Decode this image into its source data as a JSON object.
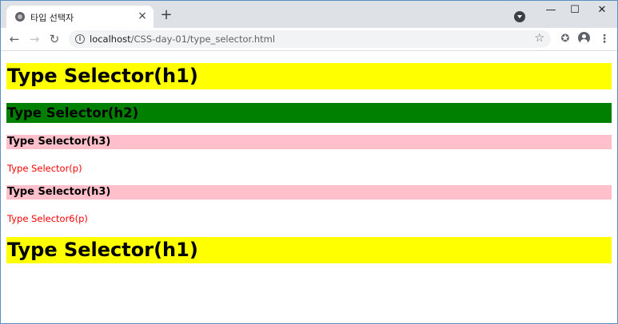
{
  "browser": {
    "tab_title": "타입 선택자",
    "tab_close": "×",
    "new_tab": "+",
    "url_host": "localhost",
    "url_path": "/CSS-day-01/type_selector.html",
    "window_controls": {
      "minimize": "—",
      "maximize": "☐",
      "close": "✕"
    },
    "icons": [
      "globe-icon",
      "back-icon",
      "forward-icon",
      "reload-icon",
      "info-icon",
      "star-icon",
      "extensions-icon",
      "profile-icon",
      "menu-icon",
      "tab-search-icon"
    ]
  },
  "page": {
    "blocks": [
      {
        "tag": "h1",
        "text": "Type Selector(h1)",
        "bg": "#ffff00"
      },
      {
        "tag": "h2",
        "text": "Type Selector(h2)",
        "bg": "#008000"
      },
      {
        "tag": "h3",
        "text": "Type Selector(h3)",
        "bg": "#ffc0cb"
      },
      {
        "tag": "p",
        "text": "Type Selector(p)",
        "color": "#ff0000"
      },
      {
        "tag": "h3",
        "text": "Type Selector(h3)",
        "bg": "#ffc0cb"
      },
      {
        "tag": "p",
        "text": "Type Selector6(p)",
        "color": "#ff0000"
      },
      {
        "tag": "h1",
        "text": "Type Selector(h1)",
        "bg": "#ffff00"
      }
    ]
  }
}
